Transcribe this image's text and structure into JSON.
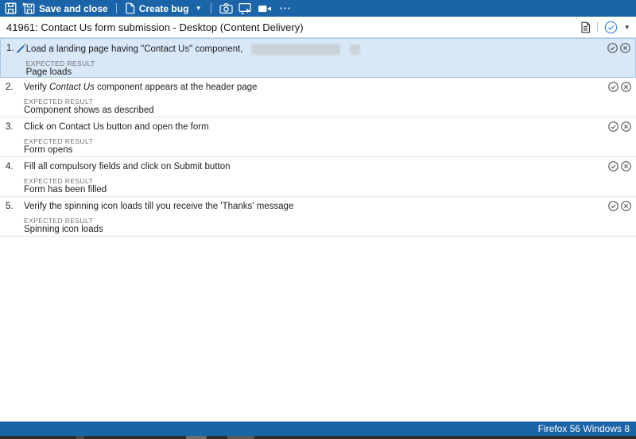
{
  "toolbar": {
    "save_and_close_label": "Save and close",
    "create_bug_label": "Create bug"
  },
  "title_bar": {
    "title": "41961: Contact Us form submission - Desktop (Content Delivery)"
  },
  "steps": {
    "expected_result_label": "EXPECTED RESULT",
    "items": [
      {
        "number": "1.",
        "action": "Load a landing page having \"Contact Us\" component,",
        "expected": "Page loads",
        "selected": true,
        "redacted": true
      },
      {
        "number": "2.",
        "action_prefix": "Verify ",
        "action_italic": "Contact Us",
        "action_suffix": " component appears at the header page",
        "expected": "Component shows as described"
      },
      {
        "number": "3.",
        "action": "Click on Contact Us button and open the form",
        "expected": "Form opens"
      },
      {
        "number": "4.",
        "action": "Fill all compulsory fields and click on Submit button",
        "expected": "Form has been filled"
      },
      {
        "number": "5.",
        "action": "Verify the spinning icon loads till you receive the 'Thanks' message",
        "expected": "Spinning icon loads"
      }
    ]
  },
  "status_bar": {
    "environment": "Firefox 56 Windows 8"
  },
  "icons": {
    "save": "floppy-disk",
    "save_and_close": "floppy-disk-close",
    "create_bug": "new-document",
    "screenshot": "camera",
    "screen_capture": "screen-with-cursor",
    "screen_recording": "video-camera",
    "more": "⋯",
    "caret_down": "▾",
    "test_case_details": "document-lines",
    "mark_outcome": "circle-check-blue",
    "step_pass": "circle-check",
    "step_fail": "circle-x",
    "edit": "pencil"
  },
  "colors": {
    "toolbar_blue": "#1b64a8",
    "selected_row_bg": "#d9e8f7",
    "selected_row_border": "#a9c9e6",
    "row_separator": "#e5e5e5",
    "outcome_gray": "#5a5a5a",
    "outcome_blue": "#4a90d5",
    "redaction_gray": "#ccd2d9"
  }
}
